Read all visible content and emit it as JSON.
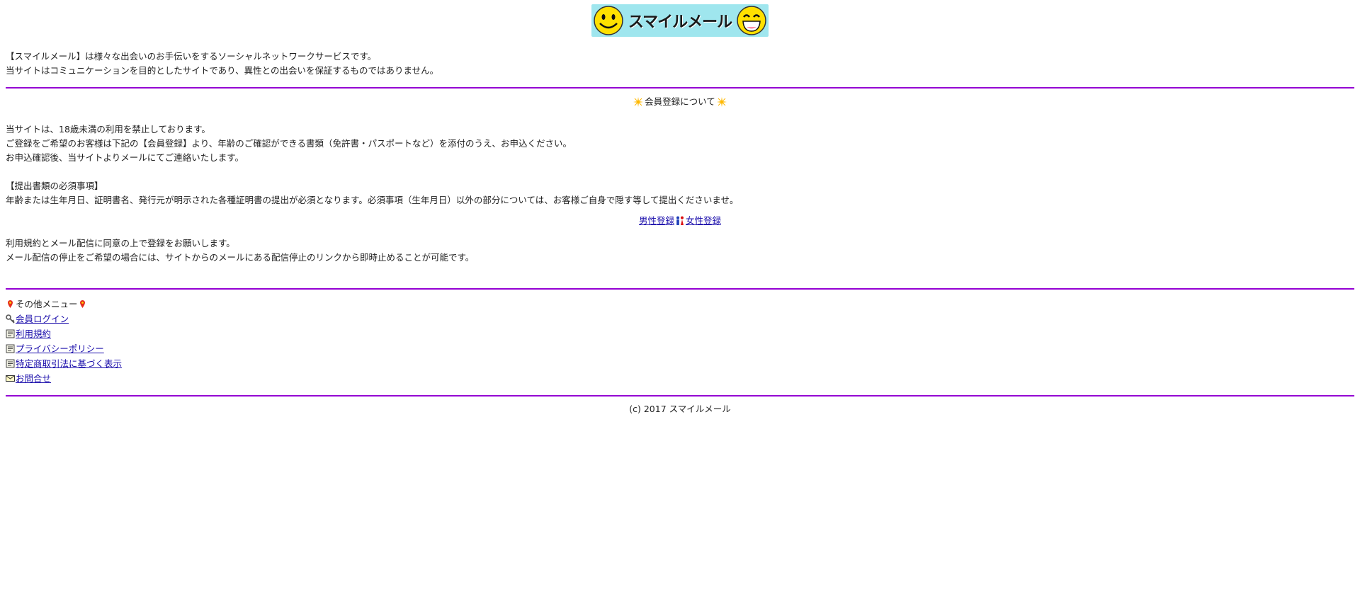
{
  "logo": {
    "text": "スマイルメール"
  },
  "intro": {
    "line1": "【スマイルメール】は様々な出会いのお手伝いをするソーシャルネットワークサービスです。",
    "line2": "当サイトはコミュニケーションを目的としたサイトであり、異性との出会いを保証するものではありません。"
  },
  "registration": {
    "title": "会員登録について",
    "line1": "当サイトは、18歳未満の利用を禁止しております。",
    "line2": "ご登録をご希望のお客様は下記の【会員登録】より、年齢のご確認ができる書類（免許書・パスポートなど）を添付のうえ、お申込ください。",
    "line3": "お申込確認後、当サイトよりメールにてご連絡いたします。",
    "req_heading": "【提出書類の必須事項】",
    "req_text": "年齢または生年月日、証明書名、発行元が明示された各種証明書の提出が必須となります。必須事項（生年月日）以外の部分については、お客様ご自身で隠す等して提出くださいませ。",
    "male_link": "男性登録",
    "female_link": "女性登録",
    "terms1": "利用規約とメール配信に同意の上で登録をお願いします。",
    "terms2": "メール配信の停止をご希望の場合には、サイトからのメールにある配信停止のリンクから即時止めることが可能です。"
  },
  "menu": {
    "title": "その他メニュー",
    "items": [
      {
        "label": "会員ログイン",
        "icon": "key-icon"
      },
      {
        "label": "利用規約",
        "icon": "document-icon"
      },
      {
        "label": "プライバシーポリシー",
        "icon": "document-icon"
      },
      {
        "label": "特定商取引法に基づく表示",
        "icon": "document-icon"
      },
      {
        "label": "お問合せ",
        "icon": "envelope-icon"
      }
    ]
  },
  "footer": {
    "copyright": "(c) 2017 スマイルメール"
  },
  "colors": {
    "divider": "#9400d3",
    "link": "#1a0dab",
    "logo_bg": "#9fe6ee"
  }
}
